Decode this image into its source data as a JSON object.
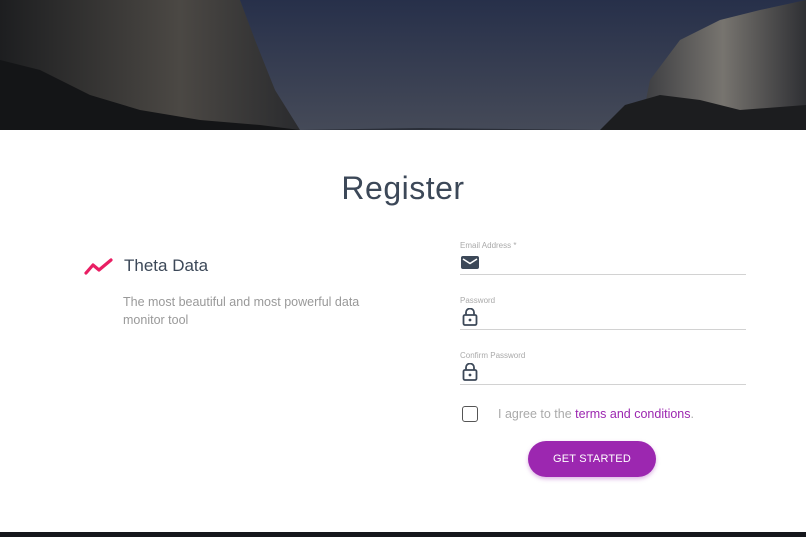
{
  "colors": {
    "accent": "#9c27b0",
    "brand_icon": "#e91e63",
    "title_text": "#3c4858",
    "muted_text": "#999999"
  },
  "hero": {
    "image_semantic": "mountain-cliffs-background"
  },
  "form": {
    "title": "Register",
    "email_label": "Email Address *",
    "email_value": "",
    "email_icon": "mail-icon",
    "password_label": "Password",
    "password_value": "",
    "password_icon": "lock-icon",
    "confirm_label": "Confirm Password",
    "confirm_value": "",
    "confirm_icon": "lock-icon",
    "agree_prefix": "I agree to the ",
    "agree_link": "terms and conditions",
    "agree_suffix": ".",
    "agree_checked": false,
    "submit_label": "GET STARTED"
  },
  "brand": {
    "icon": "trending-line-icon",
    "name": "Theta Data",
    "description": "The most beautiful and most powerful data monitor tool"
  }
}
